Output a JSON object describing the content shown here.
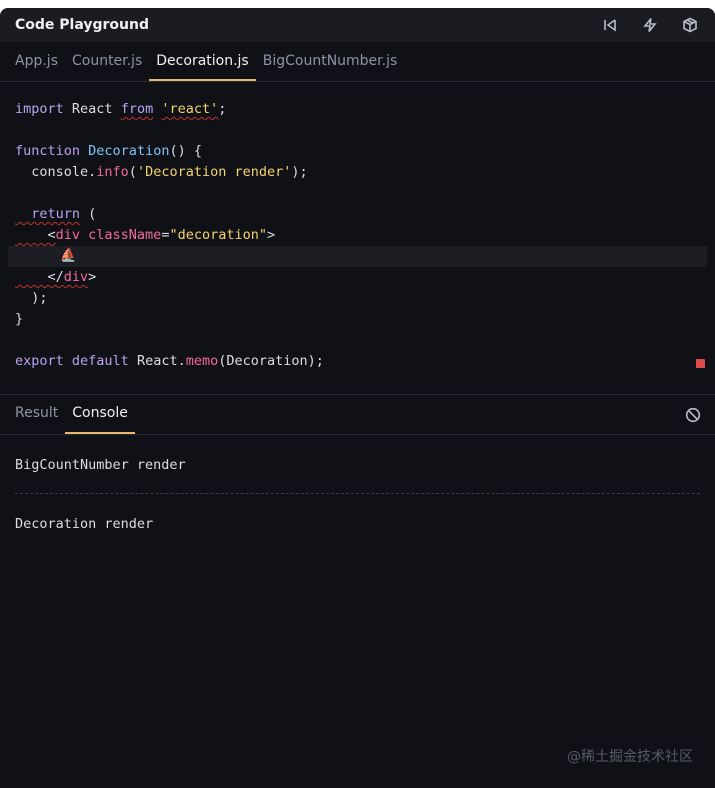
{
  "window": {
    "title": "Code Playground"
  },
  "toolbar_icons": [
    "skip-back-icon",
    "lightning-icon",
    "cube-icon"
  ],
  "file_tabs": [
    {
      "label": "App.js",
      "active": false
    },
    {
      "label": "Counter.js",
      "active": false
    },
    {
      "label": "Decoration.js",
      "active": true
    },
    {
      "label": "BigCountNumber.js",
      "active": false
    }
  ],
  "code": {
    "l1_import": "import",
    "l1_react": " React ",
    "l1_from": "from",
    "l1_str": "'react'",
    "l1_end": ";",
    "l3_function": "function",
    "l3_name": "Decoration",
    "l3_rest": "() {",
    "l4_console": "  console.",
    "l4_info": "info",
    "l4_open": "(",
    "l4_str": "'Decoration render'",
    "l4_close": ");",
    "l6_return": "  return",
    "l6_rest": " (",
    "l7_open": "    <",
    "l7_tag": "div",
    "l7_attr": " className",
    "l7_eq": "=",
    "l7_str": "\"decoration\"",
    "l7_close": ">",
    "l8_emoji": "⛵",
    "l9_open": "    </",
    "l9_tag": "div",
    "l9_close": ">",
    "l10": "  );",
    "l11": "}",
    "l13_export": "export",
    "l13_default": " default",
    "l13_react": " React.",
    "l13_memo": "memo",
    "l13_rest": "(Decoration);"
  },
  "panel_tabs": [
    {
      "label": "Result",
      "active": false
    },
    {
      "label": "Console",
      "active": true
    }
  ],
  "console_logs": [
    "BigCountNumber render",
    "Decoration render"
  ],
  "watermark": "@稀土掘金技术社区",
  "colors": {
    "accent": "#e7b96c",
    "error": "#e04a4a",
    "background": "#101116"
  }
}
